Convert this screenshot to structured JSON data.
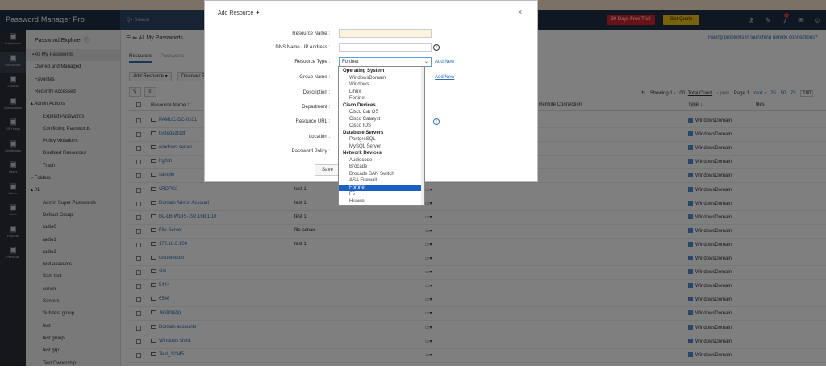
{
  "app": {
    "brand": "Password Manager Pro",
    "search_placeholder": "Search"
  },
  "topbar": {
    "trial": "30 Days Free Trial",
    "quote": "Get Quote",
    "icons": [
      "key-icon",
      "wrench-icon",
      "bell-icon",
      "mail-icon",
      "user-icon"
    ],
    "colors": {
      "trial": "#d4242c",
      "quote": "#f5c518"
    }
  },
  "leftnav": [
    {
      "label": "Dashboard",
      "icon": "dashboard-icon"
    },
    {
      "label": "Resources",
      "icon": "monitor-icon"
    },
    {
      "label": "Groups",
      "icon": "groups-icon"
    },
    {
      "label": "Connections",
      "icon": "connections-icon"
    },
    {
      "label": "SSH Keys",
      "icon": "key-icon"
    },
    {
      "label": "Certificates",
      "icon": "certificate-icon"
    },
    {
      "label": "Users",
      "icon": "users-icon"
    },
    {
      "label": "Admin",
      "icon": "admin-icon"
    },
    {
      "label": "Audit",
      "icon": "audit-icon"
    },
    {
      "label": "Reports",
      "icon": "reports-icon"
    },
    {
      "label": "Personal",
      "icon": "personal-icon"
    }
  ],
  "explorer": {
    "title": "Password Explorer",
    "items": [
      "All My Passwords",
      "Owned and Managed",
      "Favorites",
      "Recently Accessed",
      "Admin Actions",
      "Expired Passwords",
      "Conflicting Passwords",
      "Policy Violations",
      "Disabled Resources",
      "Trash",
      "Folders",
      "01",
      "Admin Super Passwords",
      "Default Group",
      "radio0",
      "radio1",
      "radio2",
      "root accounts",
      "Sam test",
      "server",
      "Servers",
      "Sub test group",
      "test",
      "test group",
      "test grp1",
      "Test Ownership"
    ]
  },
  "main": {
    "title": "All My Passwords",
    "message": "Facing problems in launching remote connections?",
    "tabs": [
      "Resources",
      "Passwords"
    ],
    "buttons": {
      "add": "Add Resource",
      "discover": "Discover R"
    },
    "paging": {
      "showing": "Showing 1 - 100",
      "total": "Total Count",
      "prev": "‹ prev",
      "page": "Page 1",
      "next": "next ›",
      "sizes": [
        "25",
        "50",
        "75",
        "100"
      ]
    },
    "columns": {
      "name": "Resource Name",
      "remote": "Remote Connection",
      "type": "Type",
      "files": "files"
    },
    "rows": [
      {
        "name": "PAMUC-DC-0101",
        "desc": "",
        "type": "WindowsDomain"
      },
      {
        "name": "testedsdfsdf",
        "desc": "",
        "type": "WindowsDomain"
      },
      {
        "name": "windows server",
        "desc": "",
        "type": "WindowsDomain"
      },
      {
        "name": "hgjfdh",
        "desc": "",
        "type": "WindowsDomain"
      },
      {
        "name": "sample",
        "desc": "",
        "type": "WindowsDomain"
      },
      {
        "name": "vROPS2",
        "desc": "test 1",
        "type": "WindowsDomain"
      },
      {
        "name": "Domain Admin Account",
        "desc": "test 1",
        "type": "WindowsDomain"
      },
      {
        "name": "BL-LB-WDIS-192.168.1.10",
        "desc": "test 1",
        "type": "WindowsDomain"
      },
      {
        "name": "File Server",
        "desc": "file server",
        "type": "WindowsDomain"
      },
      {
        "name": "172.18.6.100",
        "desc": "test 1",
        "type": "WindowsDomain"
      },
      {
        "name": "testtteedom",
        "desc": "",
        "type": "WindowsDomain"
      },
      {
        "name": "sim",
        "desc": "",
        "type": "WindowsDomain"
      },
      {
        "name": "5444",
        "desc": "",
        "type": "WindowsDomain"
      },
      {
        "name": "6546",
        "desc": "",
        "type": "WindowsDomain"
      },
      {
        "name": "Testing2yy",
        "desc": "",
        "type": "WindowsDomain"
      },
      {
        "name": "Domain accounts",
        "desc": "",
        "type": "WindowsDomain"
      },
      {
        "name": "Windows sishk",
        "desc": "",
        "type": "WindowsDomain"
      },
      {
        "name": "Test_12345",
        "desc": "",
        "type": "WindowsDomain"
      }
    ]
  },
  "modal": {
    "title": "Add Resource",
    "fields": [
      "Resource Name",
      "DNS Name / IP Address",
      "Resource Type",
      "Group Name",
      "Description",
      "Department",
      "Resource URL",
      "Location",
      "Password Policy"
    ],
    "resource_type_value": "Fortinet",
    "add_new": "Add New",
    "save": "Save",
    "dropdown": [
      {
        "h": "Operating System"
      },
      {
        "o": "WindowsDomain"
      },
      {
        "o": "Windows"
      },
      {
        "o": "Linux"
      },
      {
        "o": "Fortinet"
      },
      {
        "h": "Cisco Devices"
      },
      {
        "o": "Cisco Cat OS"
      },
      {
        "o": "Cisco Catalyst"
      },
      {
        "o": "Cisco IOS"
      },
      {
        "h": "Database Servers"
      },
      {
        "o": "PostgreSQL"
      },
      {
        "o": "MySQL Server"
      },
      {
        "h": "Network Devices"
      },
      {
        "o": "Audiocode"
      },
      {
        "o": "Brocade"
      },
      {
        "o": "Brocade SAN Switch"
      },
      {
        "o": "ASA Firewall"
      },
      {
        "o": "Fortinet",
        "sel": true
      },
      {
        "o": "F5"
      },
      {
        "o": "Huawei"
      }
    ]
  }
}
